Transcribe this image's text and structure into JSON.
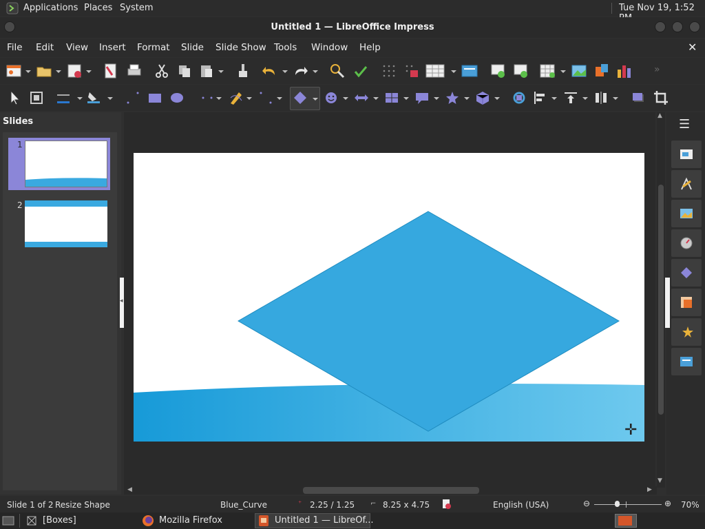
{
  "panel": {
    "applications": "Applications",
    "places": "Places",
    "system": "System",
    "clock": "Tue Nov 19,  1:52 PM"
  },
  "window": {
    "title": "Untitled 1 — LibreOffice Impress"
  },
  "menu": [
    "File",
    "Edit",
    "View",
    "Insert",
    "Format",
    "Slide",
    "Slide Show",
    "Tools",
    "Window",
    "Help"
  ],
  "slides_pane": {
    "header": "Slides",
    "items": [
      {
        "number": "1",
        "selected": true
      },
      {
        "number": "2",
        "selected": false
      }
    ]
  },
  "status": {
    "slide": "Slide 1 of 2",
    "action": "Resize Shape",
    "master": "Blue_Curve",
    "position": "2.25 / 1.25",
    "size": "8.25 x 4.75",
    "language": "English (USA)",
    "zoom": "70%",
    "zoom_level": 0.35
  },
  "taskbar": {
    "boxes": "[Boxes]",
    "firefox": "Mozilla Firefox",
    "impress": "Untitled 1 — LibreOf..."
  },
  "colors": {
    "accent": "#3aa9e0",
    "shape_fill": "#36a8df",
    "selection": "#8b86d8"
  }
}
